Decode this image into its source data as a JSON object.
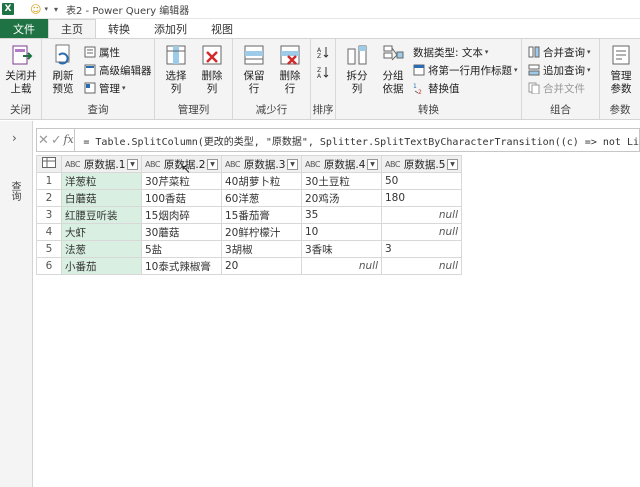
{
  "titlebar": {
    "app_icon": "X",
    "title": "表2 - Power Query 编辑器"
  },
  "tabs": [
    "文件",
    "主页",
    "转换",
    "添加列",
    "视图"
  ],
  "ribbon": {
    "close": {
      "btn": "关闭并\n上载",
      "group": "关闭"
    },
    "query": {
      "refresh": "刷新\n预览",
      "properties": "属性",
      "advanced_editor": "高级编辑器",
      "manage": "管理",
      "group": "查询"
    },
    "manage_cols": {
      "choose": "选择\n列",
      "delete": "删除\n列",
      "group": "管理列"
    },
    "reduce_rows": {
      "keep": "保留\n行",
      "delete": "删除\n行",
      "group": "减少行"
    },
    "sort": {
      "group": "排序"
    },
    "transform": {
      "split": "拆分\n列",
      "groupby": "分组\n依据",
      "datatype": "数据类型: 文本",
      "first_row": "将第一行用作标题",
      "replace": "替换值",
      "group": "转换"
    },
    "combine": {
      "merge": "合并查询",
      "append": "追加查询",
      "merge_files": "合并文件",
      "group": "组合"
    },
    "params": {
      "manage": "管理\n参数",
      "group": "参数"
    }
  },
  "left_pane": {
    "label": "查询"
  },
  "formula": "= Table.SplitColumn(更改的类型, \"原数据\", Splitter.SplitTextByCharacterTransition((c) => not Li",
  "table": {
    "headers": [
      "原数据.1",
      "原数据.2",
      "原数据.3",
      "原数据.4",
      "原数据.5"
    ],
    "rows": [
      [
        "洋葱粒",
        "30芹菜粒",
        "40胡萝卜粒",
        "30土豆粒",
        "50"
      ],
      [
        "白蘑菇",
        "100香菇",
        "60洋葱",
        "20鸡汤",
        "180"
      ],
      [
        "红腰豆听装",
        "15烟肉碎",
        "15番茄膏",
        "35",
        "null"
      ],
      [
        "大虾",
        "30蘑菇",
        "20鲜柠檬汁",
        "10",
        "null"
      ],
      [
        "法葱",
        "5盐",
        "3胡椒",
        "3香味",
        "3"
      ],
      [
        "小番茄",
        "10泰式辣椒膏",
        "20",
        "null",
        "null"
      ]
    ]
  }
}
